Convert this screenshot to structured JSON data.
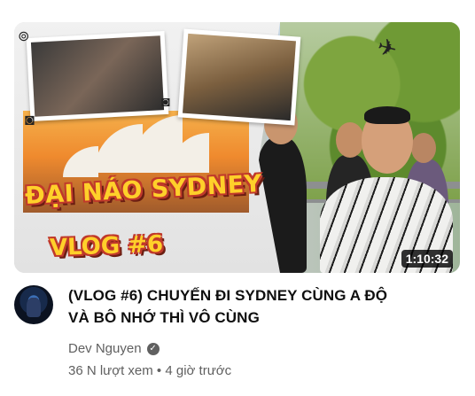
{
  "video": {
    "thumbnail": {
      "art_title": "ĐẠI NÁO SYDNEY",
      "art_vlog": "VLOG #6",
      "duration": "1:10:32"
    },
    "title_line1": "(VLOG #6) CHUYẾN ĐI SYDNEY CÙNG A ĐỘ",
    "title_line2": "VÀ BÔ NHỚ THÌ VÔ CÙNG",
    "channel_name": "Dev Nguyen",
    "views": "36 N lượt xem",
    "separator": "•",
    "age": "4 giờ trước"
  },
  "icons": {
    "verified": "verified-check-icon",
    "plane": "airplane-icon",
    "camera": "camera-icon",
    "pin": "pin-icon"
  }
}
